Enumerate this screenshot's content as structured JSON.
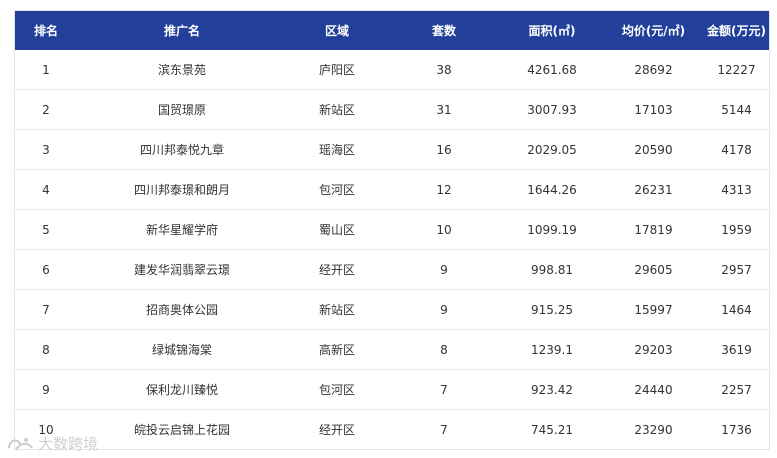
{
  "table": {
    "headers": [
      "排名",
      "推广名",
      "区域",
      "套数",
      "面积(㎡)",
      "均价(元/㎡)",
      "金额(万元)"
    ],
    "rows": [
      [
        "1",
        "滨东景苑",
        "庐阳区",
        "38",
        "4261.68",
        "28692",
        "12227"
      ],
      [
        "2",
        "国贸璟原",
        "新站区",
        "31",
        "3007.93",
        "17103",
        "5144"
      ],
      [
        "3",
        "四川邦泰悦九章",
        "瑶海区",
        "16",
        "2029.05",
        "20590",
        "4178"
      ],
      [
        "4",
        "四川邦泰璟和朗月",
        "包河区",
        "12",
        "1644.26",
        "26231",
        "4313"
      ],
      [
        "5",
        "新华星耀学府",
        "蜀山区",
        "10",
        "1099.19",
        "17819",
        "1959"
      ],
      [
        "6",
        "建发华润翡翠云璟",
        "经开区",
        "9",
        "998.81",
        "29605",
        "2957"
      ],
      [
        "7",
        "招商奥体公园",
        "新站区",
        "9",
        "915.25",
        "15997",
        "1464"
      ],
      [
        "8",
        "绿城锦海棠",
        "高新区",
        "8",
        "1239.1",
        "29203",
        "3619"
      ],
      [
        "9",
        "保利龙川臻悦",
        "包河区",
        "7",
        "923.42",
        "24440",
        "2257"
      ],
      [
        "10",
        "皖投云启锦上花园",
        "经开区",
        "7",
        "745.21",
        "23290",
        "1736"
      ]
    ]
  },
  "watermark": {
    "text": "大数跨境",
    "icon": "brand-logo-icon"
  },
  "colors": {
    "header_bg": "#22409a",
    "header_text": "#ffffff",
    "cell_text": "#333333",
    "row_border": "#e6e9ef"
  }
}
